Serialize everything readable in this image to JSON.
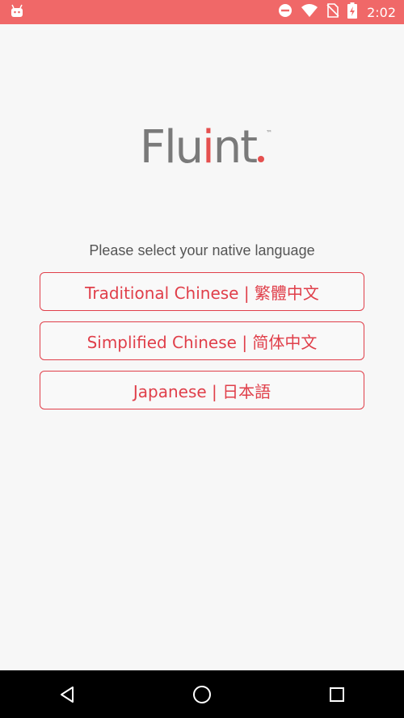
{
  "status_bar": {
    "time": "2:02",
    "icons": [
      "android-icon",
      "dnd-icon",
      "wifi-icon",
      "no-sim-icon",
      "battery-charging-icon"
    ],
    "color": "#f06868"
  },
  "logo": {
    "part1": "Flu",
    "part2": "i",
    "part3": "nt",
    "trademark": "™"
  },
  "prompt": "Please select your native language",
  "languages": [
    {
      "label": "Traditional Chinese | 繁體中文"
    },
    {
      "label": "Simplified Chinese | 简体中文"
    },
    {
      "label": "Japanese | 日本語"
    }
  ],
  "accent_color": "#e03f4a",
  "nav_bar": {
    "icons": [
      "back-icon",
      "home-icon",
      "recents-icon"
    ]
  }
}
